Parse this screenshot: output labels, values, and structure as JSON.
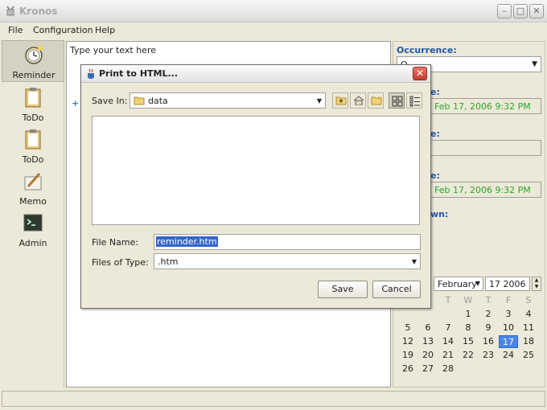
{
  "app": {
    "title": "Kronos",
    "min_glyph": "–",
    "max_glyph": "□",
    "close_glyph": "✕"
  },
  "menu": [
    "File",
    "Configuration",
    "Help"
  ],
  "nav": [
    {
      "label": "Reminder",
      "icon": "alarm-clock-icon"
    },
    {
      "label": "ToDo",
      "icon": "clipboard-icon"
    },
    {
      "label": "ToDo",
      "icon": "clipboard-icon"
    },
    {
      "label": "Memo",
      "icon": "memo-pen-icon"
    },
    {
      "label": "Admin",
      "icon": "terminal-icon"
    }
  ],
  "editor": {
    "placeholder": "Type your text here"
  },
  "right_panel": {
    "occurrence_label": "Occurrence:",
    "occurrence_value": "O",
    "label_2": "e:",
    "date_1": "Feb 17, 2006 9:32 PM",
    "label_3": "e:",
    "label_4": "e:",
    "date_2": "Feb 17, 2006 9:32 PM",
    "label_5": "wn:"
  },
  "calendar": {
    "month": "February",
    "day": "17",
    "year": "2006",
    "dow": [
      "",
      "T",
      "W",
      "T",
      "F",
      "S"
    ],
    "weeks": [
      [
        "",
        "",
        "",
        "1",
        "2",
        "3",
        "4"
      ],
      [
        "5",
        "6",
        "7",
        "8",
        "9",
        "10",
        "11"
      ],
      [
        "12",
        "13",
        "14",
        "15",
        "16",
        "17",
        "18"
      ],
      [
        "19",
        "20",
        "21",
        "22",
        "23",
        "24",
        "25"
      ],
      [
        "26",
        "27",
        "28",
        "",
        "",
        "",
        ""
      ]
    ],
    "selected_day": "17"
  },
  "dialog": {
    "title": "Print to HTML...",
    "save_in_label": "Save In:",
    "save_in_value": "data",
    "file_name_label": "File Name:",
    "file_name_value": "reminder.htm",
    "files_of_type_label": "Files of Type:",
    "files_of_type_value": ".htm",
    "save_button": "Save",
    "cancel_button": "Cancel",
    "close_glyph": "✕"
  },
  "colors": {
    "accent_blue": "#1f55a8",
    "date_green": "#2aa52a",
    "selection": "#3366cc"
  }
}
